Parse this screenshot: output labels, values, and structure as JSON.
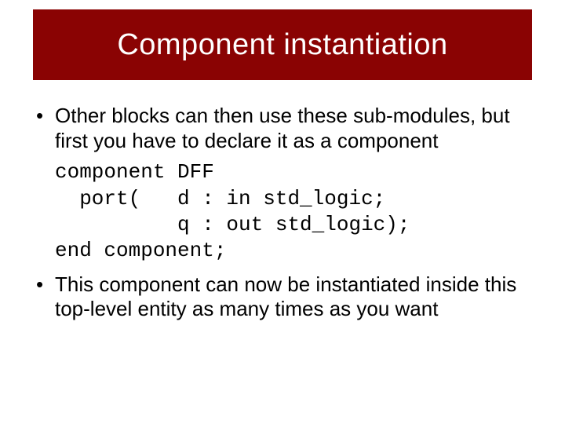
{
  "title": "Component instantiation",
  "bullets": [
    "Other blocks can then use these sub-modules, but first you have to declare it as a component",
    "This component can now be instantiated inside this top-level entity as many times as you want"
  ],
  "code": {
    "line1": "component DFF",
    "line2": "  port(   d : in std_logic;",
    "line3": "          q : out std_logic);",
    "line4": "end component;"
  }
}
